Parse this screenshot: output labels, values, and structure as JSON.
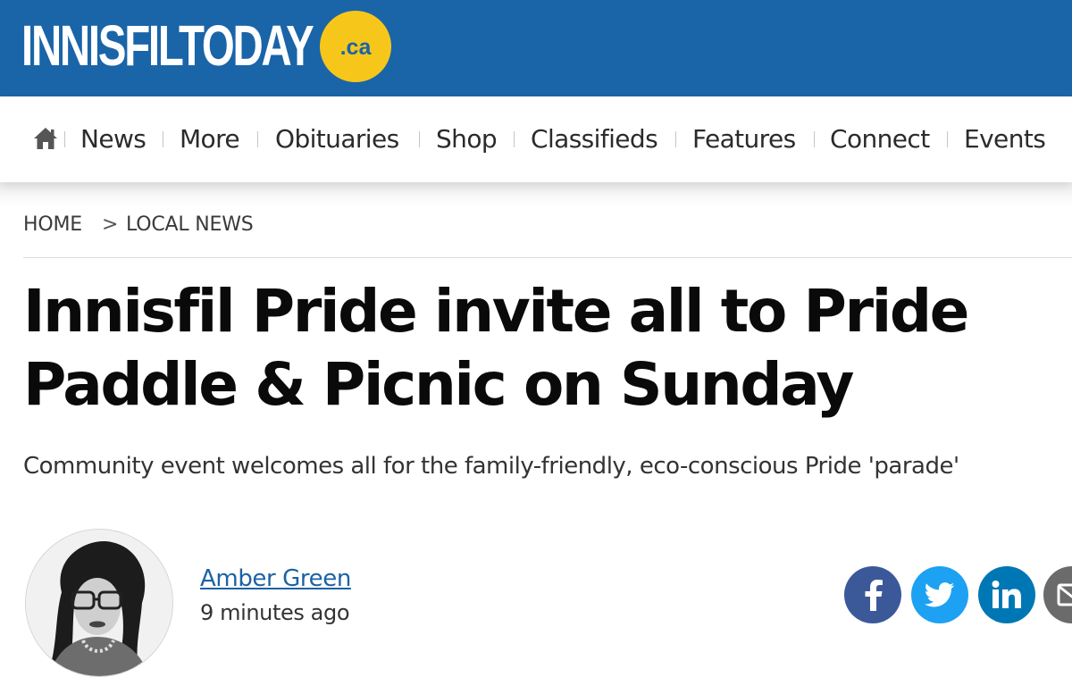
{
  "header": {
    "logo_text": "INNISFILTODAY",
    "logo_badge": ".ca",
    "background_color": "#1a64a8",
    "badge_color": "#f6c71a"
  },
  "nav": {
    "home_icon": "home-icon",
    "items": [
      "News",
      "More",
      "Obituaries",
      "Shop",
      "Classifieds",
      "Features",
      "Connect",
      "Events"
    ]
  },
  "breadcrumb": {
    "home": "HOME",
    "separator": ">",
    "current": "LOCAL NEWS"
  },
  "article": {
    "headline": "Innisfil Pride invite all to Pride Paddle & Picnic on Sunday",
    "subtitle": "Community event welcomes all for the family-friendly, eco-conscious Pride 'parade'"
  },
  "author": {
    "name": "Amber Green",
    "time": "9 minutes ago",
    "link_color": "#1d62a4"
  },
  "share": [
    {
      "network": "facebook",
      "icon": "facebook-icon",
      "color": "#3b5998"
    },
    {
      "network": "twitter",
      "icon": "twitter-icon",
      "color": "#1da1f2"
    },
    {
      "network": "linkedin",
      "icon": "linkedin-icon",
      "color": "#0077b5"
    },
    {
      "network": "email",
      "icon": "email-icon",
      "color": "#6b6b6b"
    }
  ]
}
